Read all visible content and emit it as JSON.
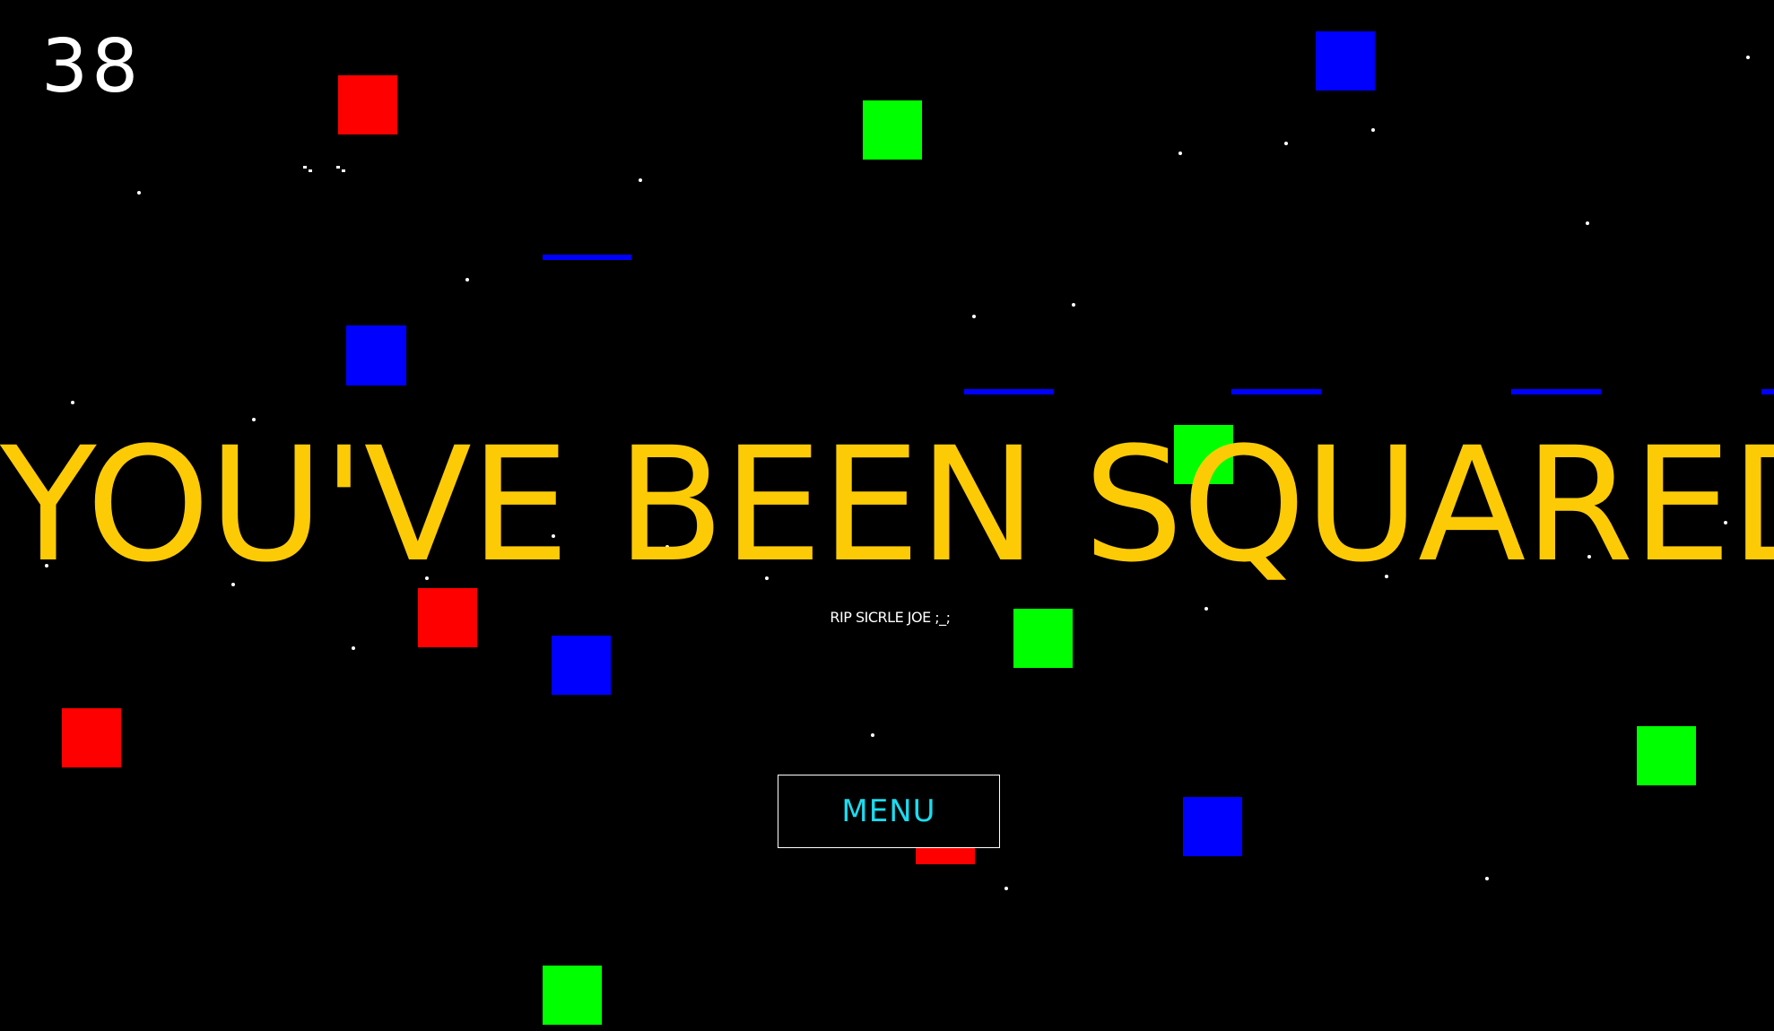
{
  "hud": {
    "score": "38"
  },
  "game_over": {
    "title": "YOU'VE BEEN SQUARED",
    "subtitle": "RIP SICRLE JOE ;_;",
    "menu_button_label": "MENU"
  },
  "colors": {
    "background": "#000000",
    "title": "#FCCB06",
    "menu_text": "#1ADCF0",
    "square_red": "#FF0000",
    "square_green": "#00FF00",
    "square_blue": "#0000FF",
    "laser": "#0000FF",
    "star": "#FFFFFF"
  },
  "entities": {
    "square_counts": {
      "red": 5,
      "green": 6,
      "blue": 5
    },
    "laser_count": 5
  }
}
